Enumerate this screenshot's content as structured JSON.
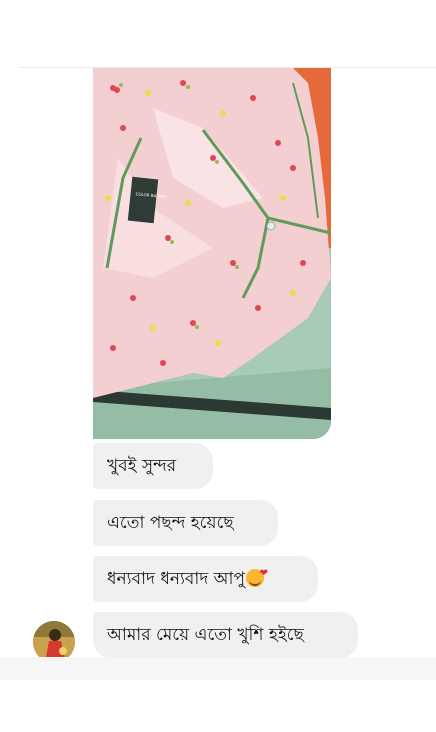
{
  "conversation": {
    "photo_alt": "shared photo",
    "photo_brand_tag": "COLOR BASKET",
    "messages": [
      {
        "text": "খুবই সুন্দর"
      },
      {
        "text": "এতো পছন্দ হয়েছে"
      },
      {
        "text": "ধন্যবাদ ধন্যবাদ আপু",
        "emoji": "smiling-face-with-hearts"
      },
      {
        "text": "আমার মেয়ে এতো খুশি হইছে"
      }
    ],
    "sender_avatar": "profile-photo"
  },
  "colors": {
    "bubble": "#f0f0f0",
    "photo_fabric": "#f4cfd1",
    "photo_piping": "#5f9b5a"
  }
}
